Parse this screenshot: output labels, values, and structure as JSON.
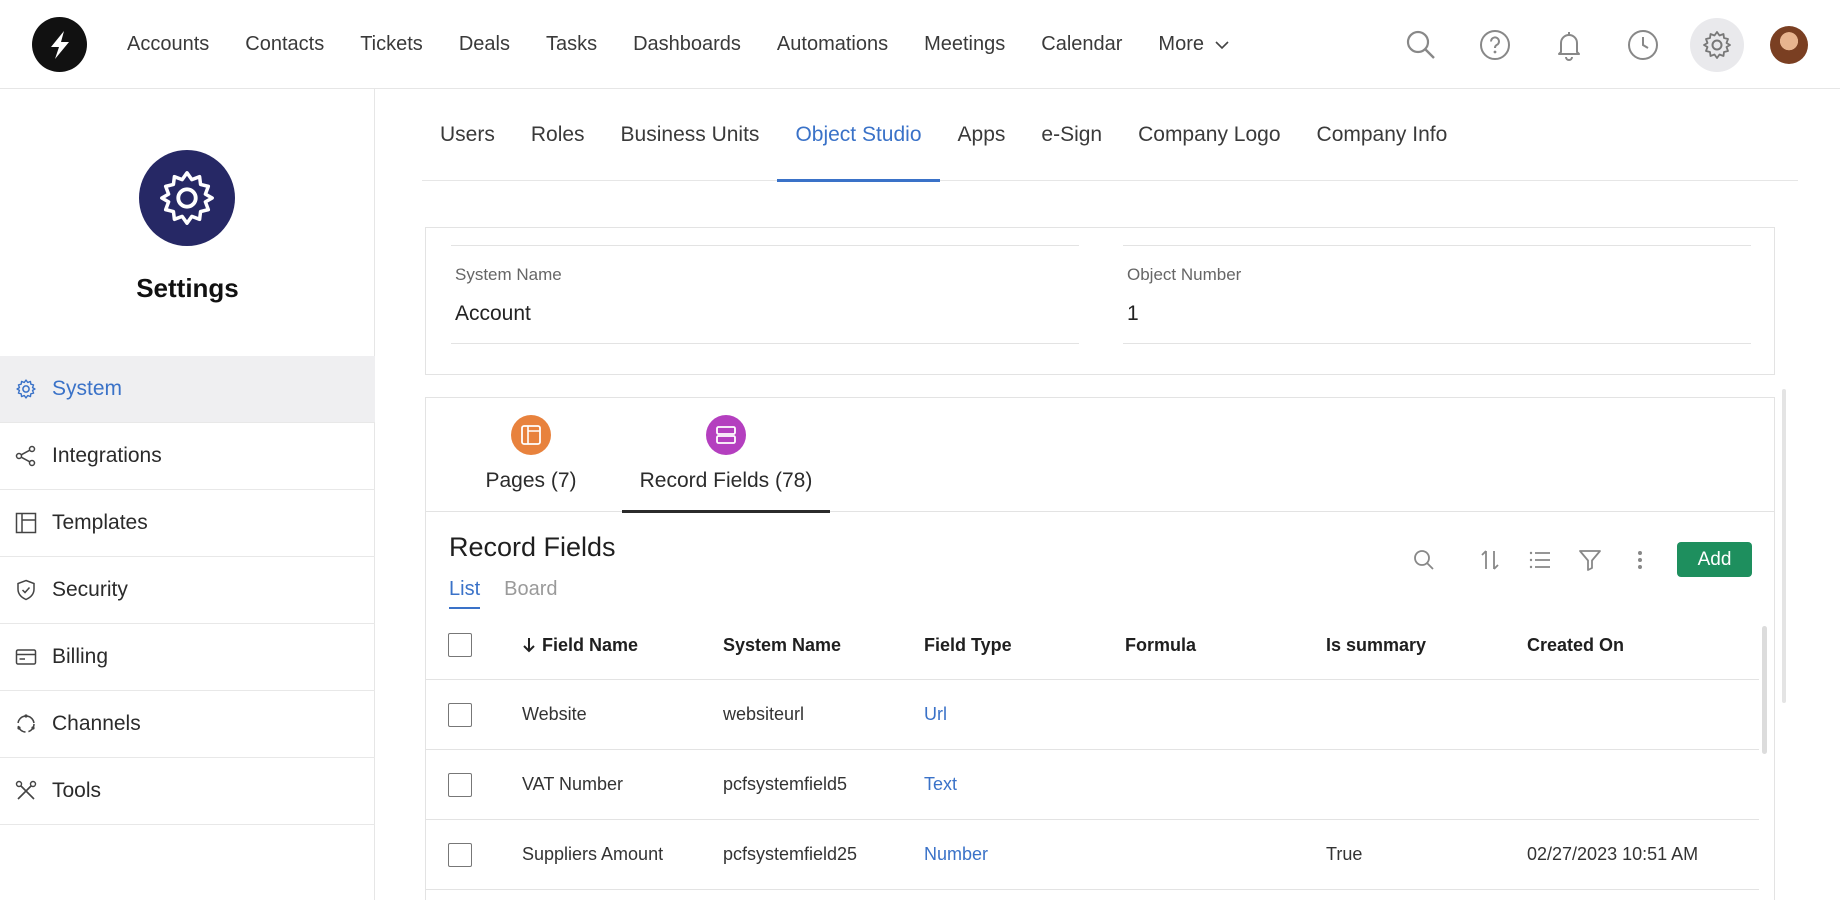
{
  "nav": {
    "items": [
      "Accounts",
      "Contacts",
      "Tickets",
      "Deals",
      "Tasks",
      "Dashboards",
      "Automations",
      "Meetings",
      "Calendar"
    ],
    "more_label": "More"
  },
  "top_icons": [
    "search-icon",
    "help-icon",
    "bell-icon",
    "clock-icon",
    "gear-icon"
  ],
  "sidebar": {
    "title": "Settings",
    "items": [
      {
        "label": "System",
        "icon": "gear-icon",
        "active": true
      },
      {
        "label": "Integrations",
        "icon": "share-icon"
      },
      {
        "label": "Templates",
        "icon": "layout-icon"
      },
      {
        "label": "Security",
        "icon": "shield-icon"
      },
      {
        "label": "Billing",
        "icon": "card-icon"
      },
      {
        "label": "Channels",
        "icon": "channels-icon"
      },
      {
        "label": "Tools",
        "icon": "tools-icon"
      }
    ]
  },
  "tabs": [
    {
      "label": "Users"
    },
    {
      "label": "Roles"
    },
    {
      "label": "Business Units"
    },
    {
      "label": "Object Studio",
      "active": true
    },
    {
      "label": "Apps"
    },
    {
      "label": "e-Sign"
    },
    {
      "label": "Company Logo"
    },
    {
      "label": "Company Info"
    }
  ],
  "info": {
    "system_name_label": "System Name",
    "system_name_value": "Account",
    "object_number_label": "Object Number",
    "object_number_value": "1"
  },
  "panel_tabs": [
    {
      "label": "Pages (7)",
      "color": "#e8823d"
    },
    {
      "label": "Record Fields (78)",
      "color": "#b43fbf",
      "active": true
    }
  ],
  "record_fields": {
    "title": "Record Fields",
    "views": [
      "List",
      "Board"
    ],
    "add_label": "Add",
    "columns": [
      "Field Name",
      "System Name",
      "Field Type",
      "Formula",
      "Is summary",
      "Created On"
    ],
    "rows": [
      {
        "field_name": "Website",
        "system_name": "websiteurl",
        "field_type": "Url",
        "formula": "",
        "is_summary": "",
        "created_on": ""
      },
      {
        "field_name": "VAT Number",
        "system_name": "pcfsystemfield5",
        "field_type": "Text",
        "formula": "",
        "is_summary": "",
        "created_on": ""
      },
      {
        "field_name": "Suppliers Amount",
        "system_name": "pcfsystemfield25",
        "field_type": "Number",
        "formula": "",
        "is_summary": "True",
        "created_on": "02/27/2023 10:51 AM"
      }
    ]
  },
  "colors": {
    "accent": "#3a72c8",
    "add_button": "#1e8f5e",
    "settings_badge": "#262865"
  }
}
